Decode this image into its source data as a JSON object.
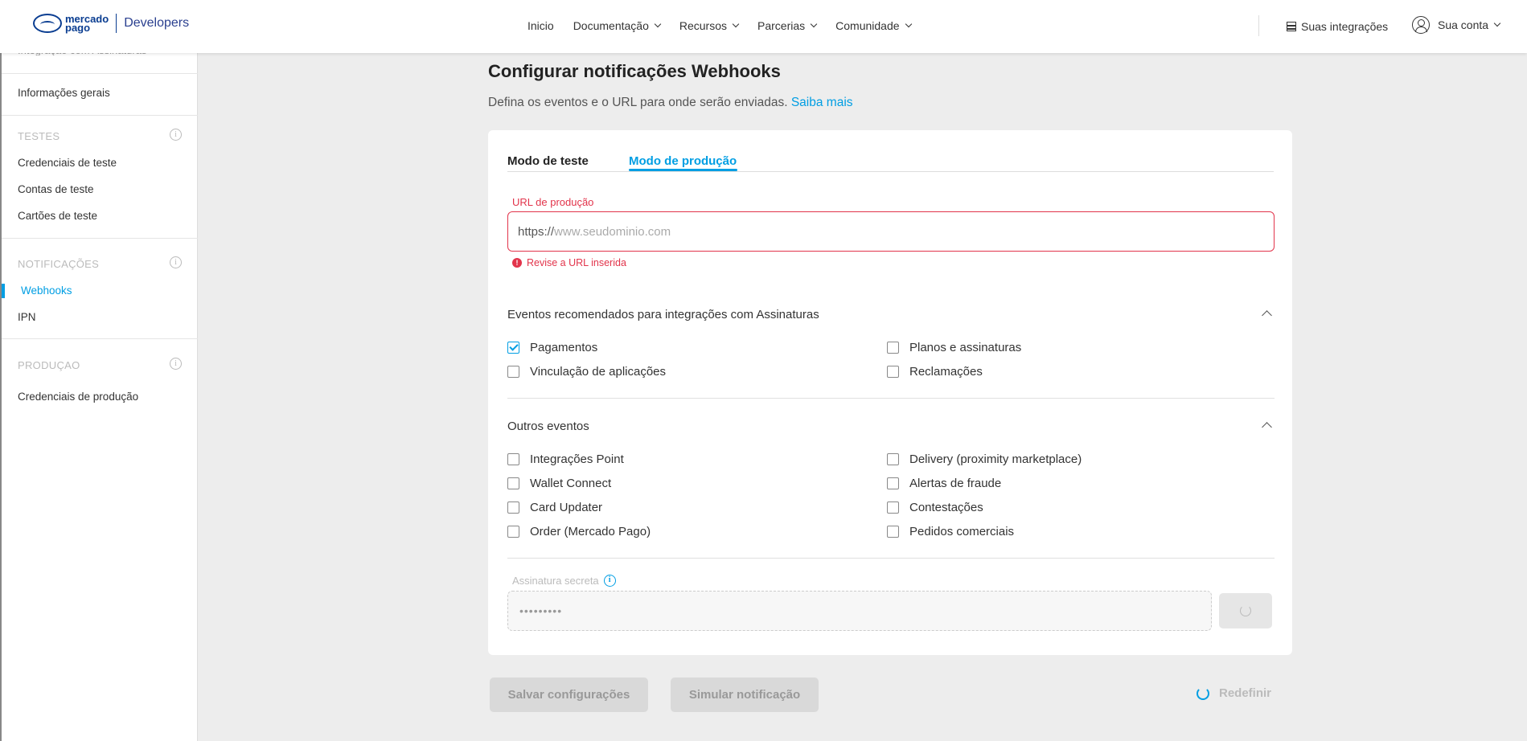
{
  "header": {
    "logo_text_1": "mercado",
    "logo_text_2": "pago",
    "brand_section": "Developers",
    "nav": [
      "Inicio",
      "Documentação",
      "Recursos",
      "Parcerias",
      "Comunidade"
    ],
    "integrations": "Suas integrações",
    "account": "Sua conta"
  },
  "sidebar": {
    "cut_item": "Integração com Assinaturas",
    "general_info": "Informações gerais",
    "tests_section": "TESTES",
    "tests_items": [
      "Credenciais de teste",
      "Contas de teste",
      "Cartões de teste"
    ],
    "notifications_section": "NOTIFICAÇÕES",
    "notifications_items": [
      "Webhooks",
      "IPN"
    ],
    "production_section": "PRODUÇAO",
    "production_items": [
      "Credenciais de produção"
    ],
    "info_glyph": "i"
  },
  "main": {
    "title": "Configurar notificações Webhooks",
    "subtitle": "Defina os eventos e o URL para onde serão enviadas.",
    "learn_more": "Saiba mais",
    "tabs": [
      "Modo de teste",
      "Modo de produção"
    ],
    "active_tab": "Modo de produção",
    "url_label": "URL de produção",
    "url_prefix": "https://",
    "url_placeholder": "www.seudominio.com",
    "url_error": "Revise a URL inserida",
    "recommended_title": "Eventos recomendados para integrações com Assinaturas",
    "recommended_events": [
      {
        "label": "Pagamentos",
        "checked": true
      },
      {
        "label": "Planos e assinaturas",
        "checked": false
      },
      {
        "label": "Vinculação de aplicações",
        "checked": false
      },
      {
        "label": "Reclamações",
        "checked": false
      }
    ],
    "other_title": "Outros eventos",
    "other_events": [
      {
        "label": "Integrações Point",
        "checked": false
      },
      {
        "label": "Delivery (proximity marketplace)",
        "checked": false
      },
      {
        "label": "Wallet Connect",
        "checked": false
      },
      {
        "label": "Alertas de fraude",
        "checked": false
      },
      {
        "label": "Card Updater",
        "checked": false
      },
      {
        "label": "Contestações",
        "checked": false
      },
      {
        "label": "Order (Mercado Pago)",
        "checked": false
      },
      {
        "label": "Pedidos comerciais",
        "checked": false
      }
    ],
    "secret_label": "Assinatura secreta",
    "secret_value": "•••••••••",
    "save_button": "Salvar configurações",
    "simulate_button": "Simular notificação",
    "reset_button": "Redefinir"
  },
  "colors": {
    "accent": "#009ee3",
    "error": "#e2344b",
    "brand": "#0a3d91"
  }
}
